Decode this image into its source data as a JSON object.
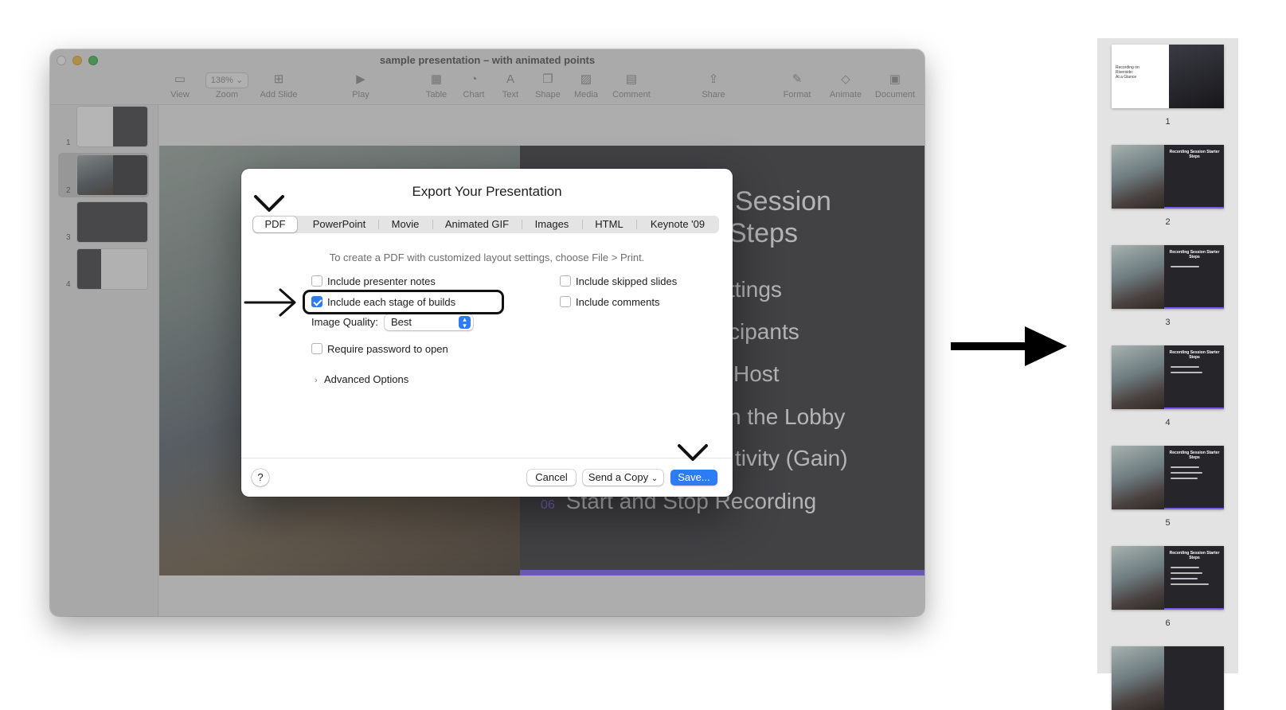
{
  "window": {
    "title": "sample presentation – with animated points",
    "toolbar": [
      {
        "label": "View",
        "icon": "view-icon",
        "glyph": "▭"
      },
      {
        "label": "Zoom",
        "icon": "zoom-icon",
        "glyph": "138%"
      },
      {
        "label": "Add Slide",
        "icon": "add-slide-icon",
        "glyph": "⊞"
      },
      {
        "label": "Play",
        "icon": "play-icon",
        "glyph": "▶"
      },
      {
        "label": "Table",
        "icon": "table-icon",
        "glyph": "▦"
      },
      {
        "label": "Chart",
        "icon": "chart-icon",
        "glyph": "◔"
      },
      {
        "label": "Text",
        "icon": "text-icon",
        "glyph": "A"
      },
      {
        "label": "Shape",
        "icon": "shape-icon",
        "glyph": "❐"
      },
      {
        "label": "Media",
        "icon": "media-icon",
        "glyph": "▨"
      },
      {
        "label": "Comment",
        "icon": "comment-icon",
        "glyph": "▤"
      },
      {
        "label": "Share",
        "icon": "share-icon",
        "glyph": "⇪"
      },
      {
        "label": "Format",
        "icon": "format-icon",
        "glyph": "✎"
      },
      {
        "label": "Animate",
        "icon": "animate-icon",
        "glyph": "◇"
      },
      {
        "label": "Document",
        "icon": "document-icon",
        "glyph": "▣"
      }
    ],
    "zoom_value": "138%",
    "slide_numbers": [
      "1",
      "2",
      "3",
      "4"
    ]
  },
  "slide": {
    "heading_line1": "Session",
    "heading_line2": "Steps",
    "items": [
      {
        "num": "",
        "text": "ttings"
      },
      {
        "num": "",
        "text": "cipants"
      },
      {
        "num": "",
        "text": "Host"
      },
      {
        "num": "",
        "text": "n the Lobby"
      },
      {
        "num": "",
        "text": "tivity (Gain)"
      },
      {
        "num": "06",
        "text": "Start and Stop Recording"
      }
    ]
  },
  "dialog": {
    "title": "Export Your Presentation",
    "tabs": [
      "PDF",
      "PowerPoint",
      "Movie",
      "Animated GIF",
      "Images",
      "HTML",
      "Keynote '09"
    ],
    "active_tab": "PDF",
    "hint": "To create a PDF with customized layout settings, choose File > Print.",
    "options": {
      "presenter_notes": {
        "label": "Include presenter notes",
        "checked": false
      },
      "each_stage_builds": {
        "label": "Include each stage of builds",
        "checked": true
      },
      "skipped_slides": {
        "label": "Include skipped slides",
        "checked": false
      },
      "comments": {
        "label": "Include comments",
        "checked": false
      },
      "require_password": {
        "label": "Require password to open",
        "checked": false
      }
    },
    "image_quality_label": "Image Quality:",
    "image_quality_value": "Best",
    "advanced_label": "Advanced Options",
    "help_label": "?",
    "cancel_label": "Cancel",
    "send_copy_label": "Send a Copy",
    "save_label": "Save..."
  },
  "exported_pages": {
    "heading": "Recording Session Starter Steps",
    "cover_title_lines": [
      "Recording on",
      "Riverside:",
      "At a Glance"
    ],
    "pages": [
      {
        "number": "1",
        "bullets": 0
      },
      {
        "number": "2",
        "bullets": 0
      },
      {
        "number": "3",
        "bullets": 1
      },
      {
        "number": "4",
        "bullets": 2
      },
      {
        "number": "5",
        "bullets": 3
      },
      {
        "number": "6",
        "bullets": 4
      }
    ]
  },
  "colors": {
    "accent_blue": "#2d7cf6",
    "slide_accent_purple": "#7a5af8",
    "slide_dark": "#2f2f33"
  }
}
